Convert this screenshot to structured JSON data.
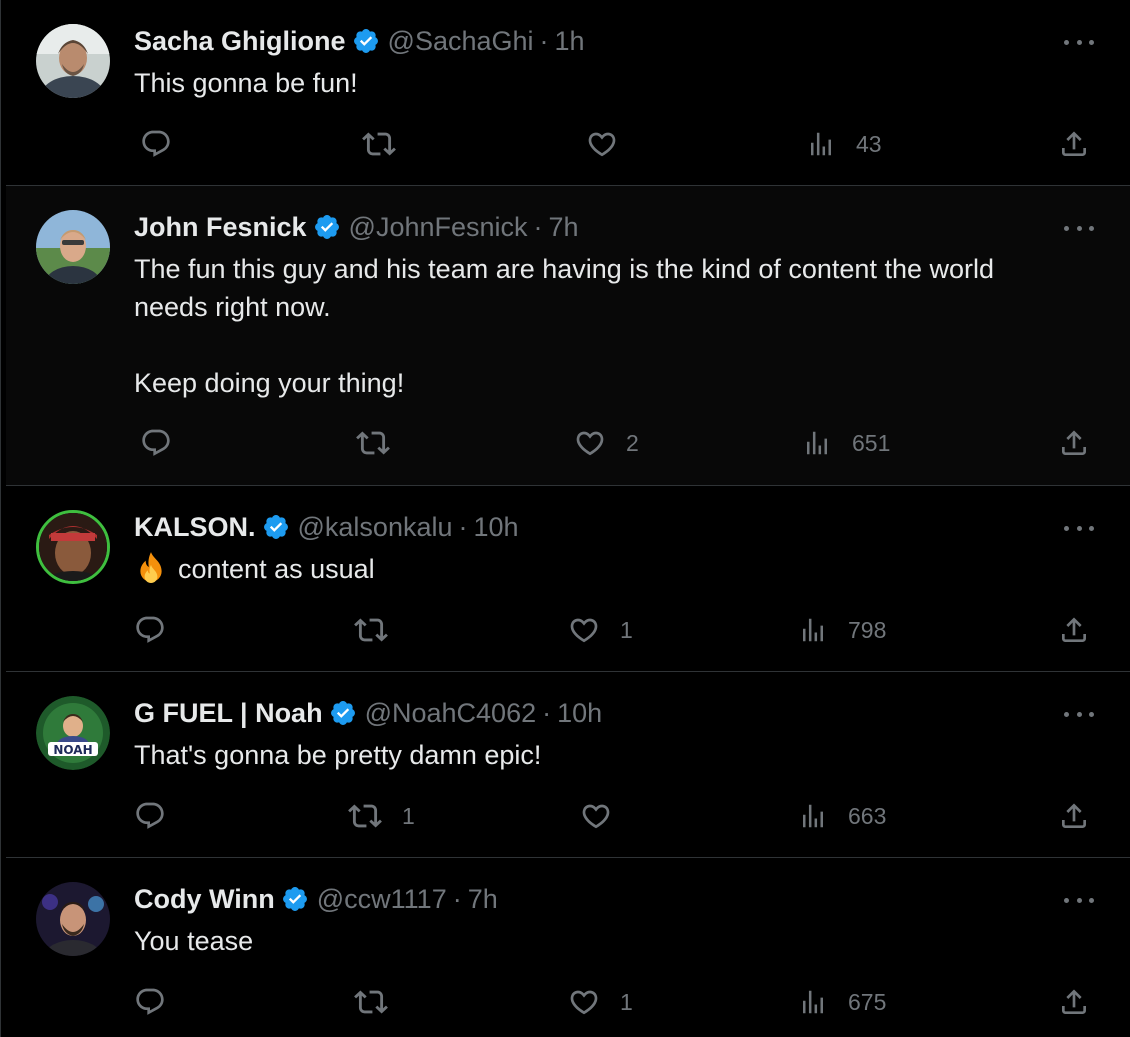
{
  "colors": {
    "background": "#000000",
    "text": "#e7e9ea",
    "muted": "#71767b",
    "border": "#2f3336",
    "verified": "#1d9bf0"
  },
  "tweets": [
    {
      "name": "Sacha Ghiglione",
      "handle": "@SachaGhi",
      "separator": "·",
      "time": "1h",
      "text": [
        "This gonna be fun!"
      ],
      "replies": "",
      "retweets": "",
      "likes": "",
      "views": "43",
      "avatar_icon": "profile-photo"
    },
    {
      "name": "John Fesnick",
      "handle": "@JohnFesnick",
      "separator": "·",
      "time": "7h",
      "text": [
        "The fun this guy and his team are having is the kind of content the world needs right now.",
        "",
        "Keep doing your thing!"
      ],
      "replies": "",
      "retweets": "",
      "likes": "2",
      "views": "651",
      "avatar_icon": "profile-photo"
    },
    {
      "name": "KALSON.",
      "handle": "@kalsonkalu",
      "separator": "·",
      "time": "10h",
      "text": [
        "content as usual"
      ],
      "emoji": "fire-emoji",
      "replies": "",
      "retweets": "",
      "likes": "1",
      "views": "798",
      "avatar_icon": "profile-photo"
    },
    {
      "name": "G FUEL | Noah",
      "handle": "@NoahC4062",
      "separator": "·",
      "time": "10h",
      "text": [
        "That's gonna be pretty damn epic!"
      ],
      "replies": "",
      "retweets": "1",
      "likes": "",
      "views": "663",
      "avatar_icon": "noah-logo",
      "avatar_text": "NOAH"
    },
    {
      "name": "Cody Winn",
      "handle": "@ccw1117",
      "separator": "·",
      "time": "7h",
      "text": [
        "You tease"
      ],
      "replies": "",
      "retweets": "",
      "likes": "1",
      "views": "675",
      "avatar_icon": "profile-photo"
    }
  ]
}
